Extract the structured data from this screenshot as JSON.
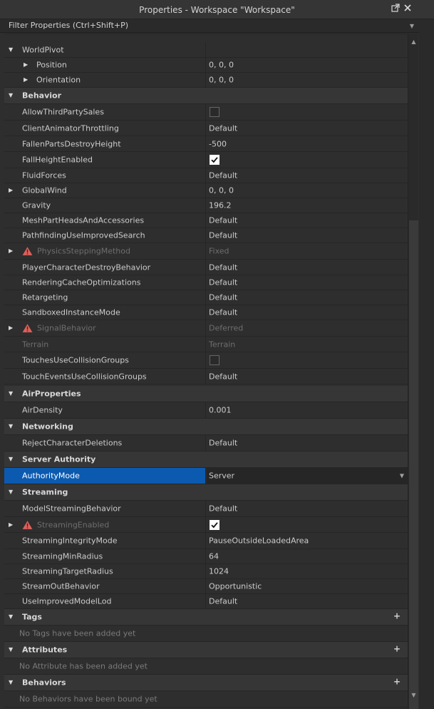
{
  "titlebar": {
    "title": "Properties - Workspace \"Workspace\"",
    "dock_icon": "undock-icon",
    "close_icon": "close-icon"
  },
  "filter": {
    "placeholder": "Filter Properties (Ctrl+Shift+P)"
  },
  "sections": {
    "world_pivot": "WorldPivot",
    "position": "Position",
    "position_val": "0, 0, 0",
    "orientation": "Orientation",
    "orientation_val": "0, 0, 0",
    "behavior": "Behavior",
    "air_properties": "AirProperties",
    "networking": "Networking",
    "server_authority": "Server Authority",
    "streaming": "Streaming",
    "tags": "Tags",
    "tags_empty": "No Tags have been added yet",
    "attributes": "Attributes",
    "attributes_empty": "No Attribute has been added yet",
    "behaviors": "Behaviors",
    "behaviors_empty": "No Behaviors have been bound yet"
  },
  "behavior_props": [
    {
      "name": "AllowThirdPartySales",
      "value": ""
    },
    {
      "name": "ClientAnimatorThrottling",
      "value": "Default"
    },
    {
      "name": "FallenPartsDestroyHeight",
      "value": "-500"
    },
    {
      "name": "FallHeightEnabled",
      "value": ""
    },
    {
      "name": "FluidForces",
      "value": "Default"
    },
    {
      "name": "GlobalWind",
      "value": "0, 0, 0"
    },
    {
      "name": "Gravity",
      "value": "196.2"
    },
    {
      "name": "MeshPartHeadsAndAccessories",
      "value": "Default"
    },
    {
      "name": "PathfindingUseImprovedSearch",
      "value": "Default"
    },
    {
      "name": "PhysicsSteppingMethod",
      "value": "Fixed"
    },
    {
      "name": "PlayerCharacterDestroyBehavior",
      "value": "Default"
    },
    {
      "name": "RenderingCacheOptimizations",
      "value": "Default"
    },
    {
      "name": "Retargeting",
      "value": "Default"
    },
    {
      "name": "SandboxedInstanceMode",
      "value": "Default"
    },
    {
      "name": "SignalBehavior",
      "value": "Deferred"
    },
    {
      "name": "Terrain",
      "value": "Terrain"
    },
    {
      "name": "TouchesUseCollisionGroups",
      "value": ""
    },
    {
      "name": "TouchEventsUseCollisionGroups",
      "value": "Default"
    }
  ],
  "air_props": [
    {
      "name": "AirDensity",
      "value": "0.001"
    }
  ],
  "networking_props": [
    {
      "name": "RejectCharacterDeletions",
      "value": "Default"
    }
  ],
  "authority_props": [
    {
      "name": "AuthorityMode",
      "value": "Server"
    }
  ],
  "streaming_props": [
    {
      "name": "ModelStreamingBehavior",
      "value": "Default"
    },
    {
      "name": "StreamingEnabled",
      "value": ""
    },
    {
      "name": "StreamingIntegrityMode",
      "value": "PauseOutsideLoadedArea"
    },
    {
      "name": "StreamingMinRadius",
      "value": "64"
    },
    {
      "name": "StreamingTargetRadius",
      "value": "1024"
    },
    {
      "name": "StreamOutBehavior",
      "value": "Opportunistic"
    },
    {
      "name": "UseImprovedModelLod",
      "value": "Default"
    }
  ],
  "checkboxes": {
    "AllowThirdPartySales": false,
    "FallHeightEnabled": true,
    "TouchesUseCollisionGroups": false,
    "StreamingEnabled": true
  },
  "colors": {
    "selection": "#0b5aaf",
    "warning": "#e0605a"
  }
}
